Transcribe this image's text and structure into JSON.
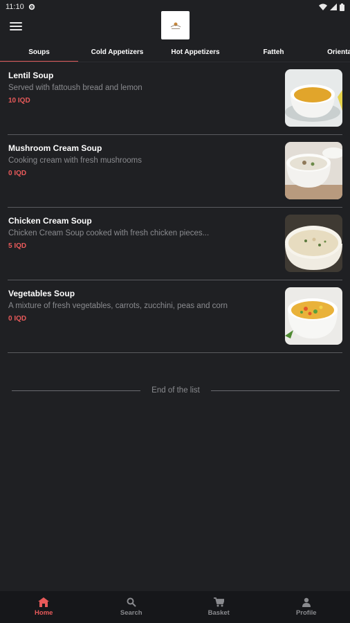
{
  "status_bar": {
    "time": "11:10"
  },
  "tabs": [
    {
      "label": "Soups",
      "active": true
    },
    {
      "label": "Cold Appetizers",
      "active": false
    },
    {
      "label": "Hot Appetizers",
      "active": false
    },
    {
      "label": "Fatteh",
      "active": false
    },
    {
      "label": "Oriental",
      "active": false
    }
  ],
  "items": [
    {
      "name": "Lentil Soup",
      "description": "Served with fattoush bread and lemon",
      "price": "10 IQD",
      "icon": "lentil-soup-image"
    },
    {
      "name": "Mushroom Cream Soup",
      "description": "Cooking cream with fresh mushrooms",
      "price": "0 IQD",
      "icon": "mushroom-soup-image"
    },
    {
      "name": "Chicken Cream Soup",
      "description": "Chicken Cream Soup cooked with fresh chicken pieces...",
      "price": "5 IQD",
      "icon": "chicken-soup-image"
    },
    {
      "name": "Vegetables Soup",
      "description": "A mixture of fresh vegetables, carrots, zucchini, peas and corn",
      "price": "0 IQD",
      "icon": "vegetable-soup-image"
    }
  ],
  "end_of_list": "End of the list",
  "bottom_nav": [
    {
      "label": "Home",
      "icon": "home-icon",
      "active": true
    },
    {
      "label": "Search",
      "icon": "search-icon",
      "active": false
    },
    {
      "label": "Basket",
      "icon": "basket-icon",
      "active": false
    },
    {
      "label": "Profile",
      "icon": "profile-icon",
      "active": false
    }
  ],
  "colors": {
    "background": "#1f2023",
    "accent": "#e85a5a",
    "muted_text": "#8a8b8f",
    "nav_background": "#16171a"
  }
}
